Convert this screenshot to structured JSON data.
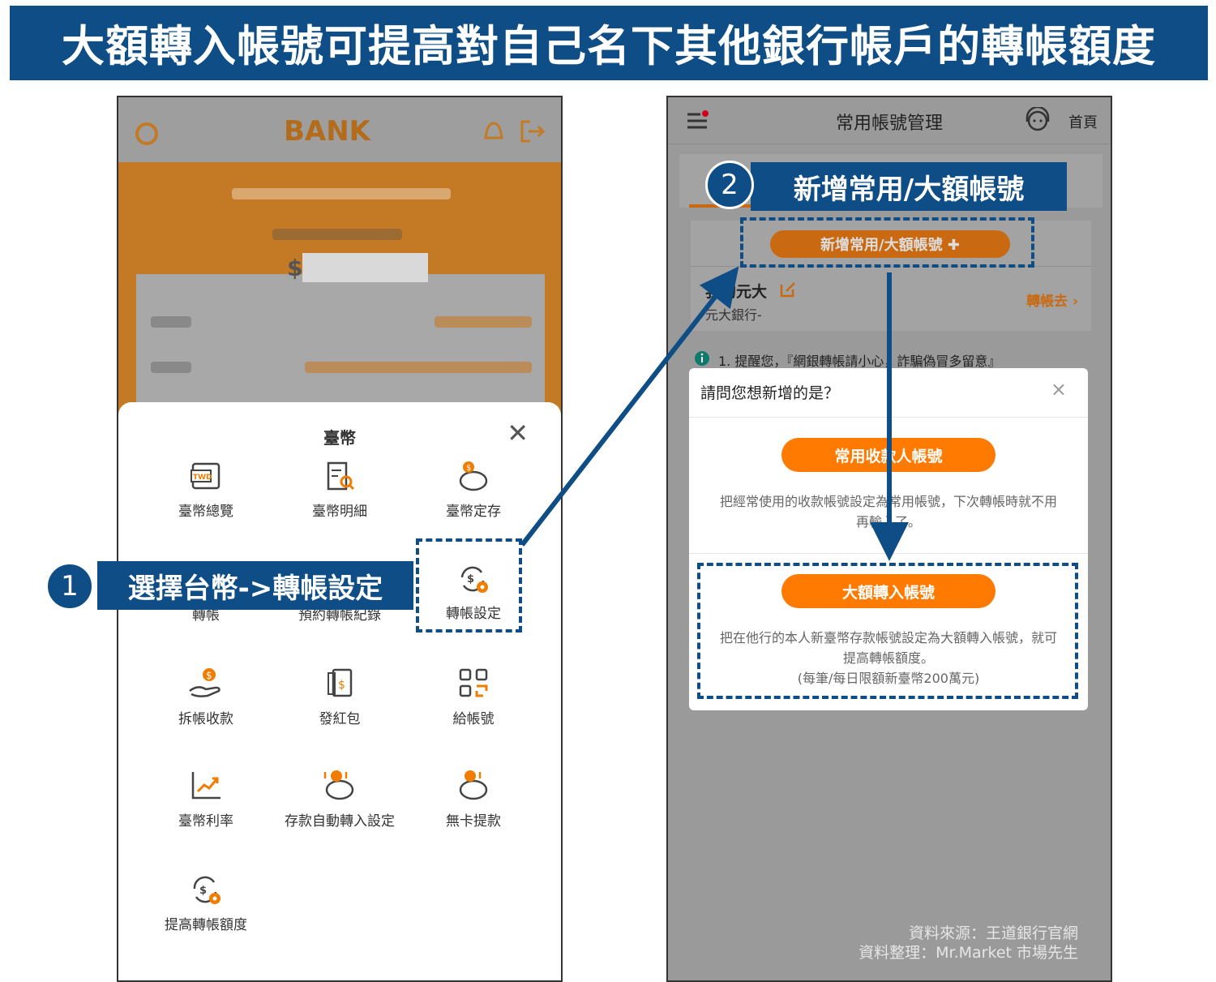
{
  "banner": {
    "title": "大額轉入帳號可提高對自己名下其他銀行帳戶的轉帳額度"
  },
  "left_phone": {
    "logo": "BANK",
    "balance_symbol": "$",
    "sheet": {
      "title": "臺幣",
      "items": [
        {
          "label": "臺幣總覽",
          "icon": "twd-wallet-icon"
        },
        {
          "label": "臺幣明細",
          "icon": "document-search-icon"
        },
        {
          "label": "臺幣定存",
          "icon": "piggy-bank-icon"
        },
        {
          "label": "轉帳",
          "icon": "transfer-icon"
        },
        {
          "label": "預約轉帳紀錄",
          "icon": "schedule-icon"
        },
        {
          "label": "轉帳設定",
          "icon": "transfer-settings-icon"
        },
        {
          "label": "拆帳收款",
          "icon": "hand-coin-icon"
        },
        {
          "label": "發紅包",
          "icon": "red-envelope-icon"
        },
        {
          "label": "給帳號",
          "icon": "qr-code-icon"
        },
        {
          "label": "臺幣利率",
          "icon": "chart-up-icon"
        },
        {
          "label": "存款自動轉入設定",
          "icon": "piggy-auto-icon"
        },
        {
          "label": "無卡提款",
          "icon": "cardless-withdraw-icon"
        },
        {
          "label": "提高轉帳額度",
          "icon": "raise-limit-icon"
        }
      ]
    },
    "callout": {
      "number": "1",
      "text": "選擇台幣->轉帳設定"
    }
  },
  "right_phone": {
    "header_title": "常用帳號管理",
    "home_label": "首頁",
    "add_button": "新增常用/大額帳號 ✚",
    "account_name": "我的元大",
    "bank_name": "元大銀行-",
    "transfer_link": "轉帳去 ›",
    "notice": "1. 提醒您，『網銀轉帳請小心，詐騙偽冒多留意』",
    "modal": {
      "title": "請問您想新增的是？",
      "close": "×",
      "option1_button": "常用收款人帳號",
      "option1_desc_line1": "把經常使用的收款帳號設定為常用帳號，下次轉帳時就不用",
      "option1_desc_line2": "再輸入了。",
      "option2_button": "大額轉入帳號",
      "option2_desc_line1": "把在他行的本人新臺幣存款帳號設定為大額轉入帳號，就可",
      "option2_desc_line2": "提高轉帳額度。",
      "option2_desc_line3": "(每筆/每日限額新臺幣200萬元)"
    },
    "callout": {
      "number": "2",
      "text": "新增常用/大額帳號"
    },
    "source_line1": "資料來源：王道銀行官網",
    "source_line2": "資料整理：Mr.Market 市場先生"
  },
  "colors": {
    "accent": "#0e4d85",
    "orange": "#ff7a00"
  }
}
